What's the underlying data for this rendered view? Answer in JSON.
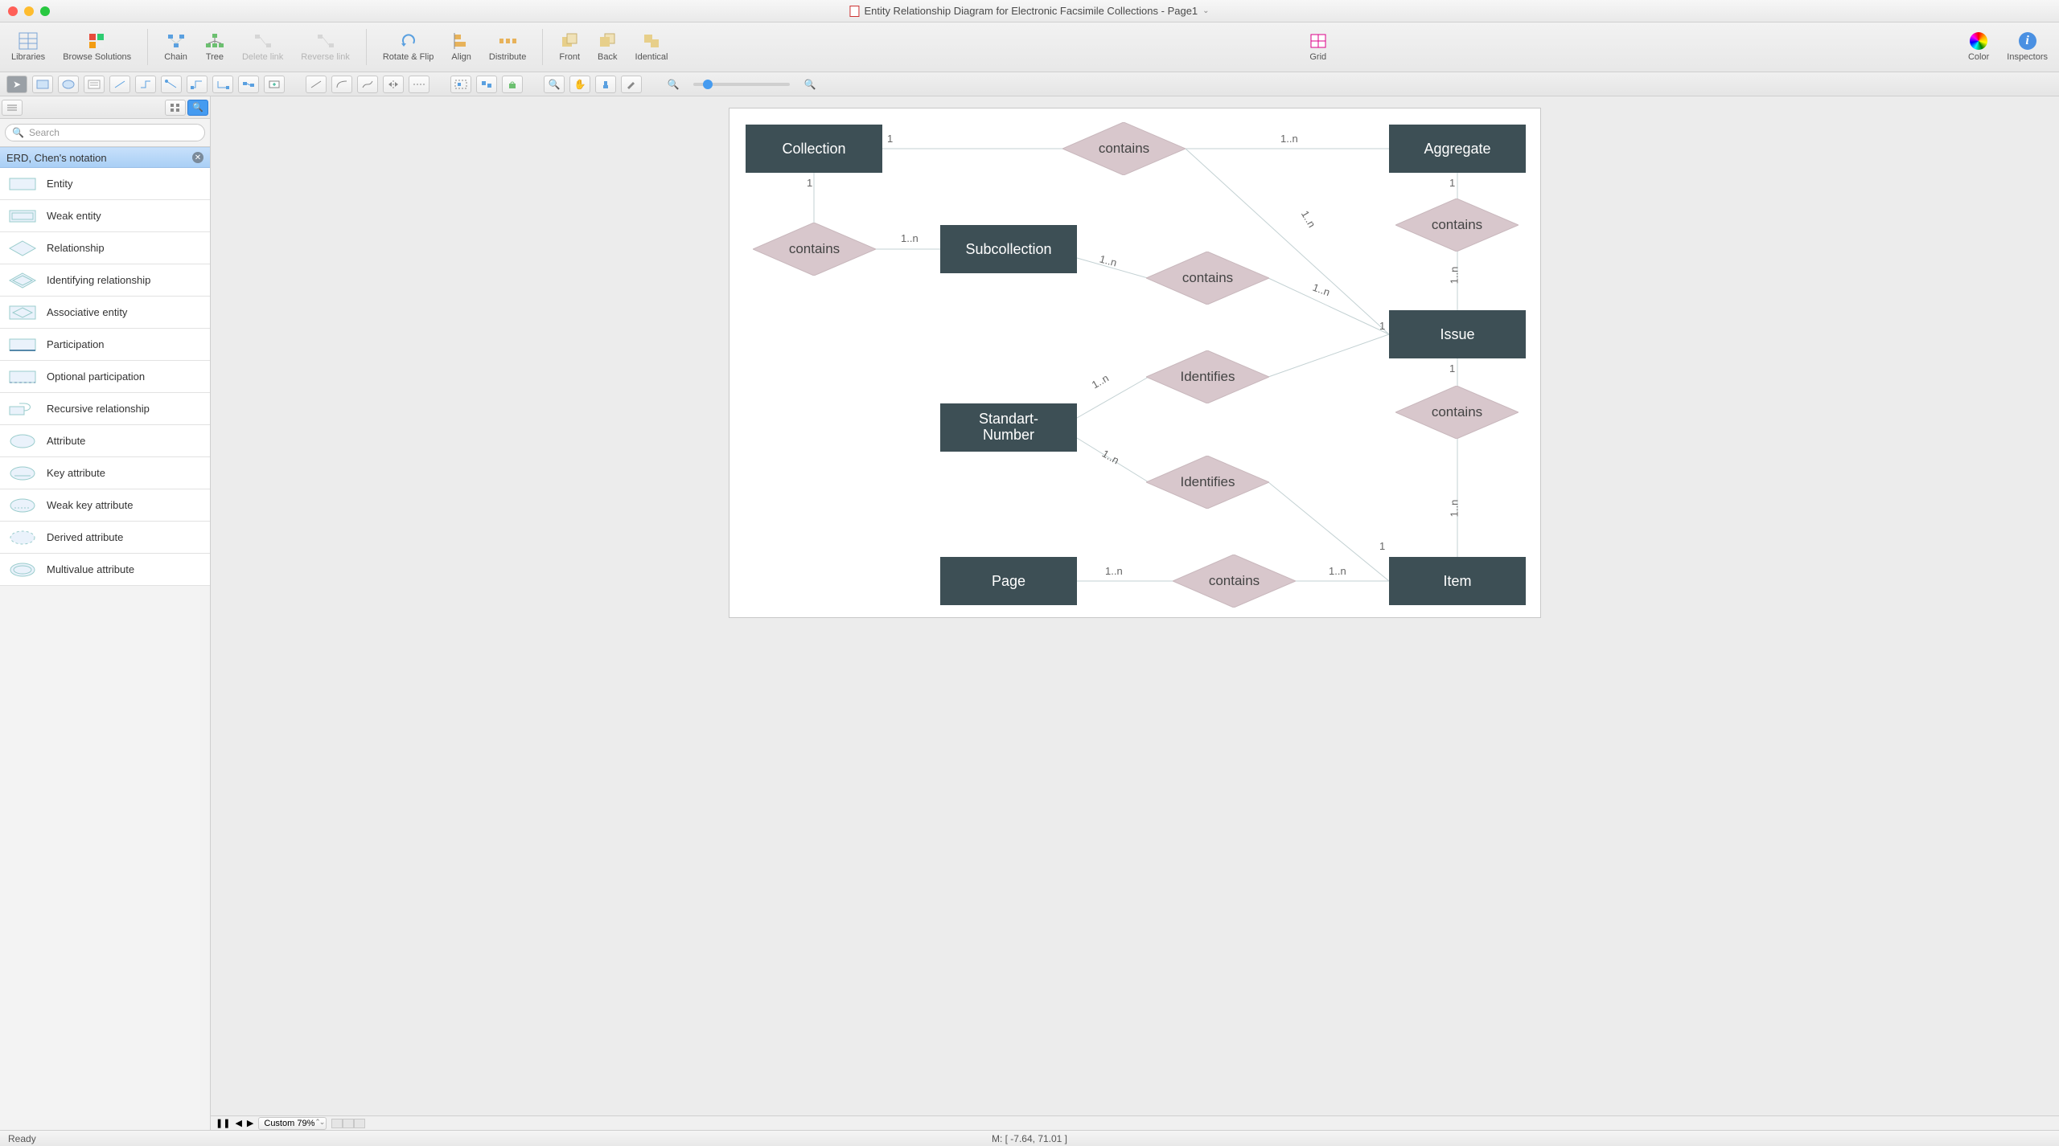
{
  "title": "Entity Relationship Diagram for Electronic Facsimile Collections - Page1",
  "toolbar": {
    "libraries": "Libraries",
    "browse": "Browse Solutions",
    "chain": "Chain",
    "tree": "Tree",
    "delete_link": "Delete link",
    "reverse_link": "Reverse link",
    "rotate_flip": "Rotate & Flip",
    "align": "Align",
    "distribute": "Distribute",
    "front": "Front",
    "back": "Back",
    "identical": "Identical",
    "grid": "Grid",
    "color": "Color",
    "inspectors": "Inspectors"
  },
  "search": {
    "placeholder": "Search"
  },
  "stencil_heading": "ERD, Chen's notation",
  "stencils": [
    "Entity",
    "Weak entity",
    "Relationship",
    "Identifying relationship",
    "Associative entity",
    "Participation",
    "Optional participation",
    "Recursive relationship",
    "Attribute",
    "Key attribute",
    "Weak key attribute",
    "Derived attribute",
    "Multivalue attribute"
  ],
  "diagram": {
    "entities": {
      "collection": "Collection",
      "aggregate": "Aggregate",
      "subcollection": "Subcollection",
      "issue": "Issue",
      "std_number_l1": "Standart-",
      "std_number_l2": "Number",
      "page": "Page",
      "item": "Item"
    },
    "relationships": {
      "contains": "contains",
      "identifies": "Identifies"
    },
    "card": {
      "one": "1",
      "one_n": "1..n"
    }
  },
  "zoom": {
    "label": "Custom 79%"
  },
  "status": {
    "ready": "Ready",
    "mouse": "M: [ -7.64, 71.01 ]"
  }
}
